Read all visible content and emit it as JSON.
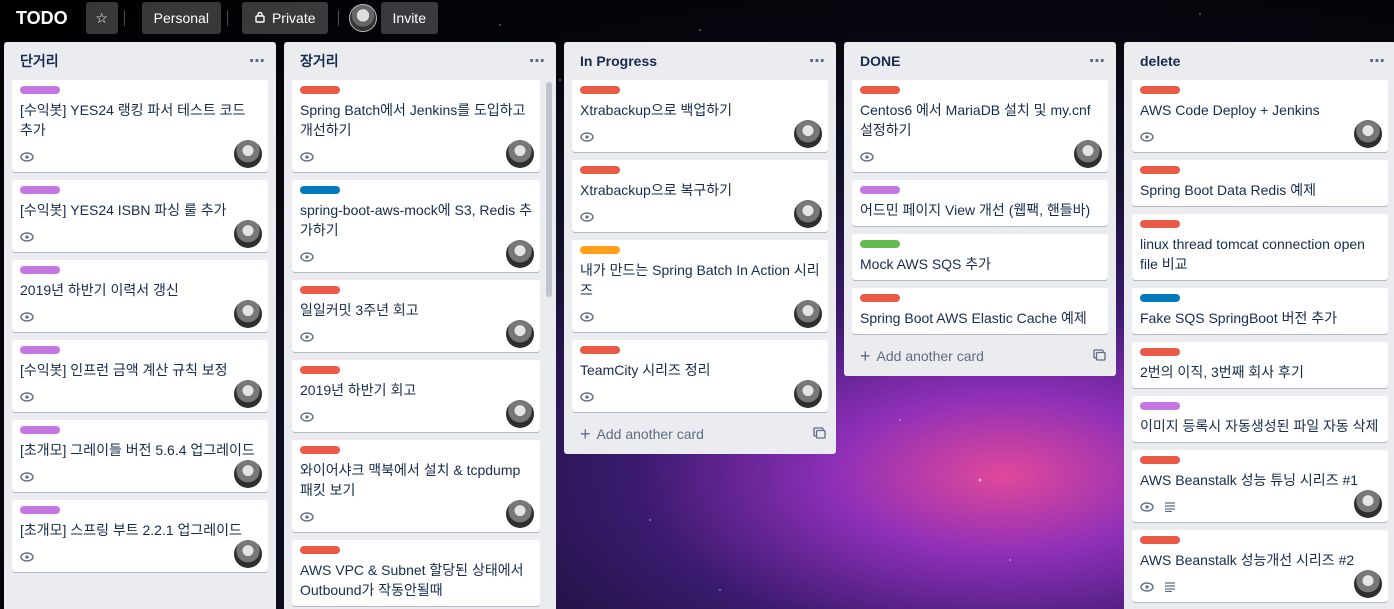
{
  "header": {
    "title": "TODO",
    "personal_label": "Personal",
    "private_label": "Private",
    "invite_label": "Invite"
  },
  "colors": {
    "purple": "#c377e0",
    "red": "#eb5a46",
    "blue": "#0079bf",
    "orange": "#ff9f1a",
    "green": "#61bd4f"
  },
  "lists": [
    {
      "title": "단거리",
      "cards": [
        {
          "label_color": "purple",
          "title": "[수익봇] YES24 랭킹 파서 테스트 코드 추가",
          "eye": true,
          "desc": false
        },
        {
          "label_color": "purple",
          "title": "[수익봇] YES24 ISBN 파싱 룰 추가",
          "eye": true,
          "desc": false
        },
        {
          "label_color": "purple",
          "title": "2019년 하반기 이력서 갱신",
          "eye": true,
          "desc": false
        },
        {
          "label_color": "purple",
          "title": "[수익봇] 인프런 금액 계산 규칙 보정",
          "eye": true,
          "desc": false
        },
        {
          "label_color": "purple",
          "title": "[초개모] 그레이들 버전 5.6.4 업그레이드",
          "eye": true,
          "desc": false
        },
        {
          "label_color": "purple",
          "title": "[초개모] 스프링 부트 2.2.1 업그레이드",
          "eye": true,
          "desc": false
        }
      ]
    },
    {
      "title": "장거리",
      "cards": [
        {
          "label_color": "red",
          "title": "Spring Batch에서 Jenkins를 도입하고 개선하기",
          "eye": true,
          "desc": false
        },
        {
          "label_color": "blue",
          "title": "spring-boot-aws-mock에 S3, Redis 추가하기",
          "eye": true,
          "desc": false
        },
        {
          "label_color": "red",
          "title": "일일커밋 3주년 회고",
          "eye": true,
          "desc": false
        },
        {
          "label_color": "red",
          "title": "2019년 하반기 회고",
          "eye": true,
          "desc": false
        },
        {
          "label_color": "red",
          "title": "와이어샤크 맥북에서 설치 & tcpdump 패킷 보기",
          "eye": true,
          "desc": false
        },
        {
          "label_color": "red",
          "title": "AWS VPC & Subnet 할당된 상태에서 Outbound가 작동안될때",
          "eye": false,
          "desc": false
        }
      ]
    },
    {
      "title": "In Progress",
      "cards": [
        {
          "label_color": "red",
          "title": "Xtrabackup으로 백업하기",
          "eye": true,
          "desc": false
        },
        {
          "label_color": "red",
          "title": "Xtrabackup으로 복구하기",
          "eye": true,
          "desc": false
        },
        {
          "label_color": "orange",
          "title": "내가 만드는 Spring Batch In Action 시리즈",
          "eye": true,
          "desc": false
        },
        {
          "label_color": "red",
          "title": "TeamCity 시리즈 정리",
          "eye": true,
          "desc": false
        }
      ],
      "add_label": "Add another card"
    },
    {
      "title": "DONE",
      "cards": [
        {
          "label_color": "red",
          "title": "Centos6 에서 MariaDB 설치 및 my.cnf 설정하기",
          "eye": true,
          "desc": false
        },
        {
          "label_color": "purple",
          "title": "어드민 페이지 View 개선 (웹팩, 핸들바)",
          "eye": false,
          "desc": false
        },
        {
          "label_color": "green",
          "title": "Mock AWS SQS 추가",
          "eye": false,
          "desc": false
        },
        {
          "label_color": "red",
          "title": "Spring Boot AWS Elastic Cache 예제",
          "eye": false,
          "desc": false
        }
      ],
      "add_label": "Add another card"
    },
    {
      "title": "delete",
      "cards": [
        {
          "label_color": "red",
          "title": "AWS Code Deploy + Jenkins",
          "eye": true,
          "desc": false
        },
        {
          "label_color": "red",
          "title": "Spring Boot Data Redis 예제",
          "eye": false,
          "desc": false
        },
        {
          "label_color": "red",
          "title": "linux thread tomcat connection open file 비교",
          "eye": false,
          "desc": false
        },
        {
          "label_color": "blue",
          "title": "Fake SQS SpringBoot 버전 추가",
          "eye": false,
          "desc": false
        },
        {
          "label_color": "red",
          "title": "2번의 이직, 3번째 회사 후기",
          "eye": false,
          "desc": false
        },
        {
          "label_color": "purple",
          "title": "이미지 등록시 자동생성된 파일 자동 삭제",
          "eye": false,
          "desc": false
        },
        {
          "label_color": "red",
          "title": "AWS Beanstalk 성능 튜닝 시리즈 #1",
          "eye": true,
          "desc": true
        },
        {
          "label_color": "red",
          "title": "AWS Beanstalk 성능개선 시리즈 #2",
          "eye": true,
          "desc": true
        }
      ]
    }
  ]
}
